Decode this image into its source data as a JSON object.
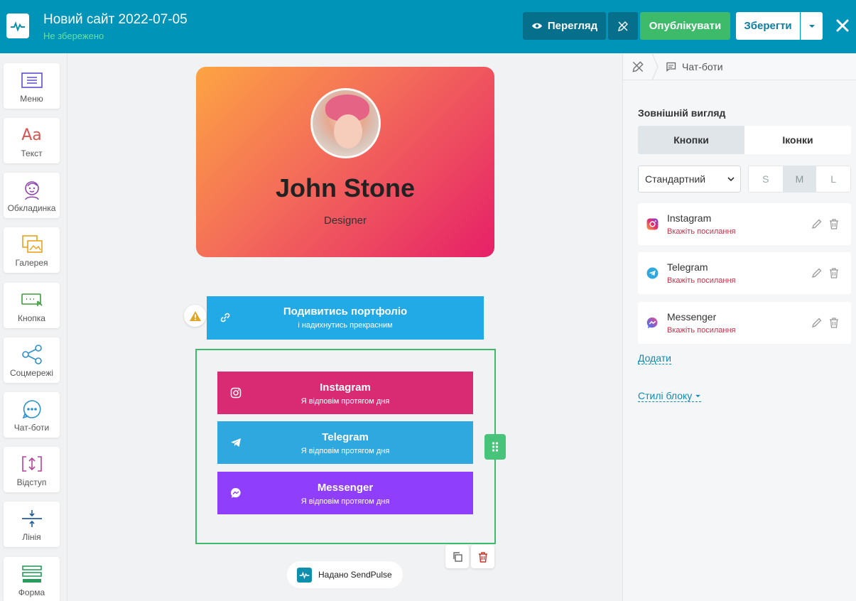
{
  "header": {
    "title": "Новий сайт 2022-07-05",
    "status": "Не збережено",
    "preview_label": "Перегляд",
    "publish_label": "Опублікувати",
    "save_label": "Зберегти"
  },
  "sidebar": {
    "items": [
      {
        "label": "Меню",
        "icon": "menu-icon"
      },
      {
        "label": "Текст",
        "icon": "text-icon"
      },
      {
        "label": "Обкладинка",
        "icon": "cover-icon"
      },
      {
        "label": "Галерея",
        "icon": "gallery-icon"
      },
      {
        "label": "Кнопка",
        "icon": "button-icon"
      },
      {
        "label": "Соцмережі",
        "icon": "share-icon"
      },
      {
        "label": "Чат-боти",
        "icon": "chatbot-icon"
      },
      {
        "label": "Відступ",
        "icon": "spacing-icon"
      },
      {
        "label": "Лінія",
        "icon": "line-icon"
      },
      {
        "label": "Форма",
        "icon": "form-icon"
      }
    ]
  },
  "canvas": {
    "profile": {
      "name": "John Stone",
      "role": "Designer"
    },
    "portfolio_button": {
      "title": "Подивитись портфоліо",
      "subtitle": "і надихнутись прекрасним"
    },
    "social_buttons": [
      {
        "title": "Instagram",
        "subtitle": "Я відповім протягом дня",
        "color": "#d92b74"
      },
      {
        "title": "Telegram",
        "subtitle": "Я відповім протягом дня",
        "color": "#2fa8e0"
      },
      {
        "title": "Messenger",
        "subtitle": "Я відповім протягом дня",
        "color": "#8f3ffc"
      }
    ],
    "powered_by": "Надано SendPulse"
  },
  "right_panel": {
    "breadcrumb": "Чат-боти",
    "appearance_title": "Зовнішній вигляд",
    "tabs": [
      {
        "label": "Кнопки"
      },
      {
        "label": "Іконки"
      }
    ],
    "style_select": {
      "value": "Стандартний"
    },
    "sizes": [
      {
        "label": "S"
      },
      {
        "label": "M"
      },
      {
        "label": "L"
      }
    ],
    "active_size": "M",
    "links": [
      {
        "name": "Instagram",
        "hint": "Вкажіть посилання"
      },
      {
        "name": "Telegram",
        "hint": "Вкажіть посилання"
      },
      {
        "name": "Messenger",
        "hint": "Вкажіть посилання"
      }
    ],
    "add_label": "Додати",
    "block_styles_label": "Стилі блоку"
  },
  "colors": {
    "topbar": "#0094b8",
    "publish": "#3dbb6b",
    "selection": "#3dbb6b",
    "portfolio": "#22aae6"
  }
}
